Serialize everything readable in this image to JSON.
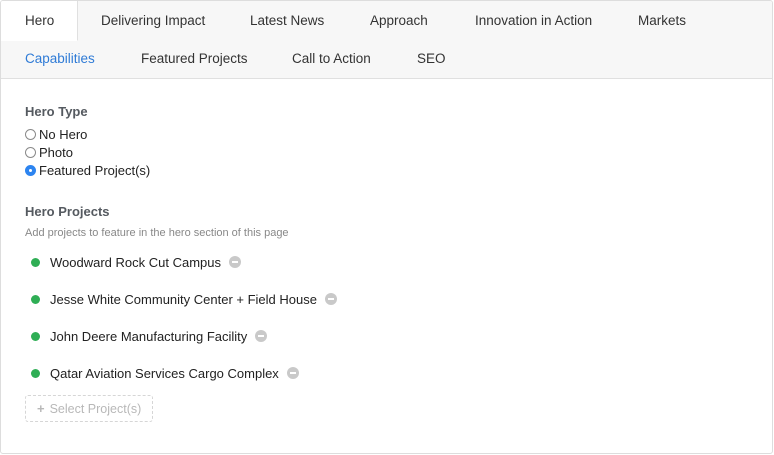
{
  "tabs_row1": [
    {
      "label": "Hero",
      "active": true
    },
    {
      "label": "Delivering Impact"
    },
    {
      "label": "Latest News"
    },
    {
      "label": "Approach"
    },
    {
      "label": "Innovation in Action"
    },
    {
      "label": "Markets"
    }
  ],
  "tabs_row2": [
    {
      "label": "Capabilities",
      "highlight": true
    },
    {
      "label": "Featured Projects"
    },
    {
      "label": "Call to Action"
    },
    {
      "label": "SEO"
    }
  ],
  "hero_type": {
    "title": "Hero Type",
    "options": [
      {
        "label": "No Hero",
        "checked": false
      },
      {
        "label": "Photo",
        "checked": false
      },
      {
        "label": "Featured Project(s)",
        "checked": true
      }
    ]
  },
  "hero_projects": {
    "title": "Hero Projects",
    "help": "Add projects to feature in the hero section of this page",
    "items": [
      {
        "name": "Woodward Rock Cut Campus"
      },
      {
        "name": "Jesse White Community Center + Field House"
      },
      {
        "name": "John Deere Manufacturing Facility"
      },
      {
        "name": "Qatar Aviation Services Cargo Complex"
      }
    ],
    "select_label": "Select Project(s)"
  },
  "colors": {
    "accent": "#2f7bd6",
    "status_green": "#2fae55",
    "radio_checked": "#2d84f0"
  }
}
